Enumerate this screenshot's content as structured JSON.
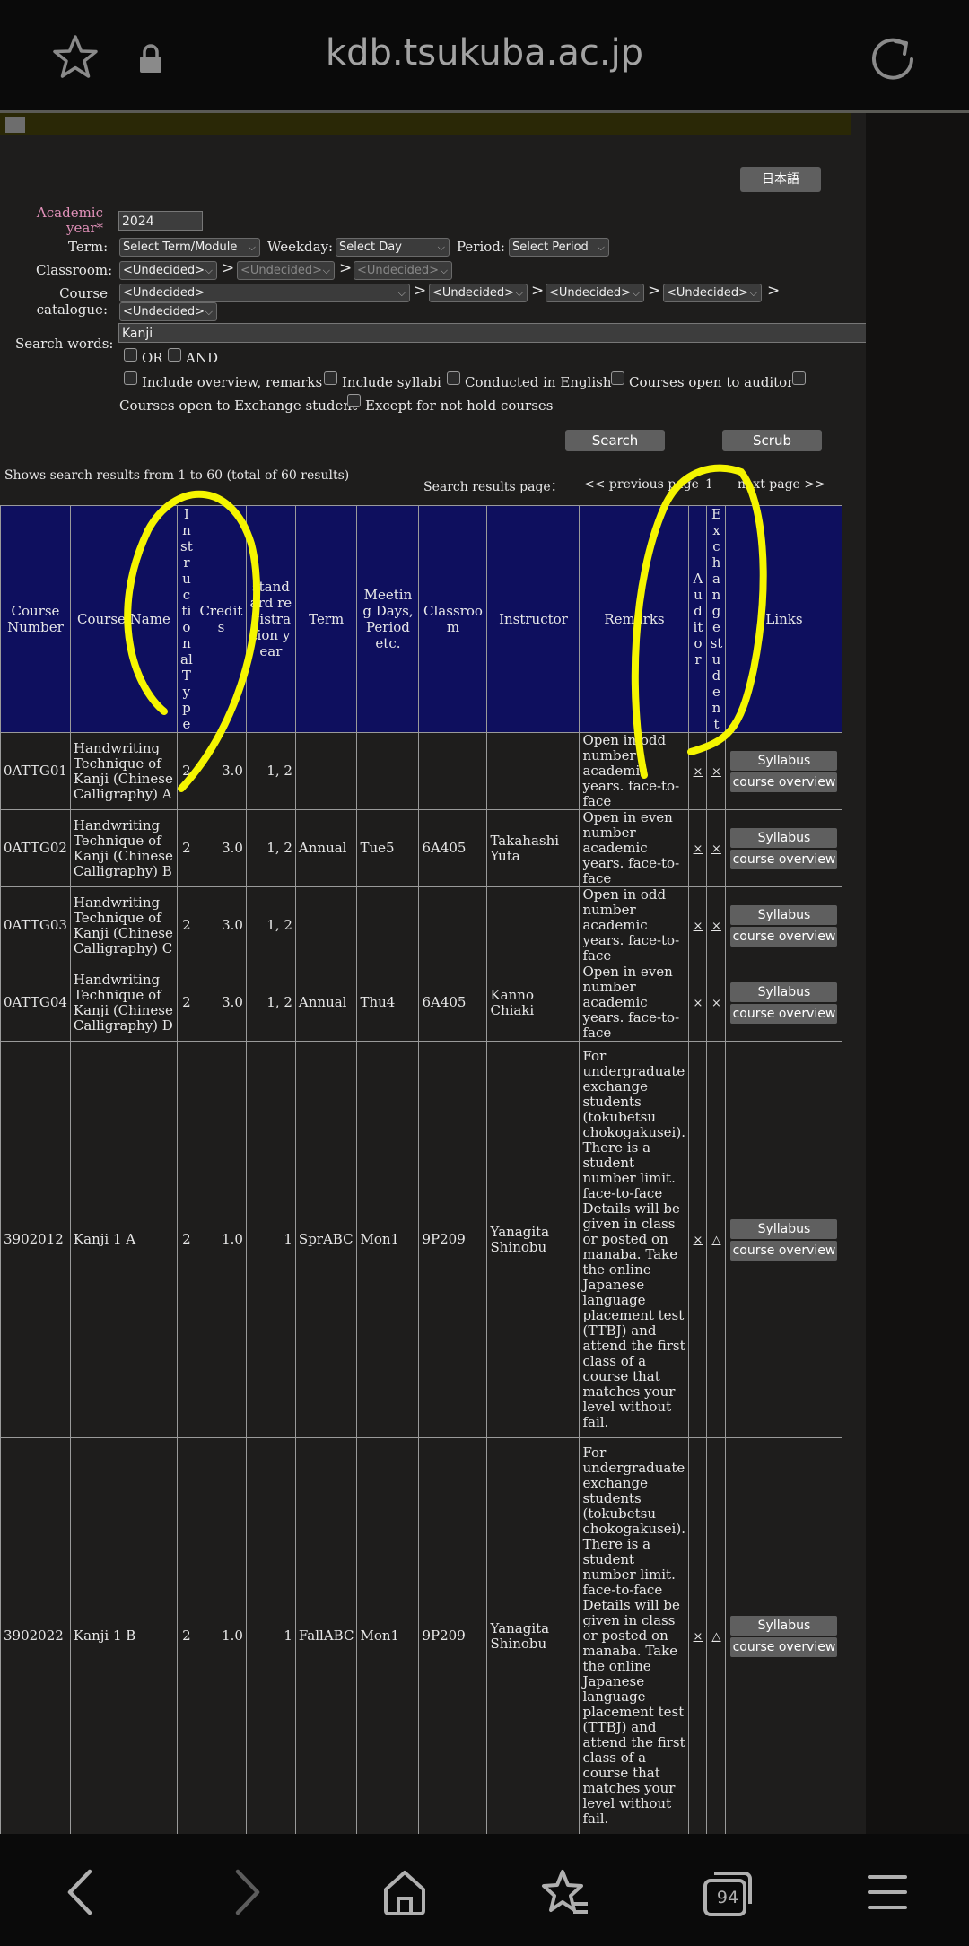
{
  "browser": {
    "url": "kdb.tsukuba.ac.jp",
    "tab_count": "94"
  },
  "page": {
    "lang_button": "日本語",
    "form": {
      "academic_year_label": "Academic year*",
      "academic_year_value": "2024",
      "term_label": "Term:",
      "term_value": "Select Term/Module",
      "weekday_label": "Weekday:",
      "weekday_value": "Select Day",
      "period_label": "Period:",
      "period_value": "Select Period",
      "classroom_label": "Classroom:",
      "undecided": "<Undecided>",
      "catalogue_label": "Course catalogue:",
      "search_words_label": "Search words:",
      "search_words_value": "Kanji",
      "opt_or": "OR",
      "opt_and": "AND",
      "opt_overview": "Include overview, remarks",
      "opt_syllabi": "Include syllabi",
      "opt_english": "Conducted in English",
      "opt_auditor": "Courses open to auditor",
      "opt_exchange": "Courses open to Exchange student",
      "opt_except": "Except for not hold courses",
      "search_button": "Search",
      "scrub_button": "Scrub"
    },
    "results": {
      "summary": "Shows search results from 1 to 60 (total of 60 results)",
      "page_label": "Search results page：",
      "prev": "<< previous page",
      "page_num": "1",
      "next": "next page >>"
    },
    "table": {
      "headers": {
        "course_number": "Course Number",
        "course_name": "Course Name",
        "instr_type": "Instructional Type",
        "credits": "Credits",
        "std_year": "standard registration year",
        "term": "Term",
        "meeting": "Meeting Days,Period etc.",
        "classroom": "Classroom",
        "instructor": "Instructor",
        "remarks": "Remarks",
        "auditor": "Auditor",
        "exchange": "Exchangestudent",
        "links": "Links"
      },
      "syllabus_label": "Syllabus",
      "overview_label": "course overview",
      "rows": [
        {
          "num": "0ATTG01",
          "name": "Handwriting Technique of Kanji (Chinese Calligraphy) A",
          "type": "2",
          "credits": "3.0",
          "year": "1, 2",
          "term": "",
          "meeting": "",
          "room": "",
          "instructor": "",
          "remarks": "Open in odd number academic years. face-to-face",
          "auditor": "×",
          "exchange": "×"
        },
        {
          "num": "0ATTG02",
          "name": "Handwriting Technique of Kanji (Chinese Calligraphy) B",
          "type": "2",
          "credits": "3.0",
          "year": "1, 2",
          "term": "Annual",
          "meeting": "Tue5",
          "room": "6A405",
          "instructor": "Takahashi Yuta",
          "remarks": "Open in even number academic years. face-to-face",
          "auditor": "×",
          "exchange": "×"
        },
        {
          "num": "0ATTG03",
          "name": "Handwriting Technique of Kanji (Chinese Calligraphy) C",
          "type": "2",
          "credits": "3.0",
          "year": "1, 2",
          "term": "",
          "meeting": "",
          "room": "",
          "instructor": "",
          "remarks": "Open in odd number academic years. face-to-face",
          "auditor": "×",
          "exchange": "×"
        },
        {
          "num": "0ATTG04",
          "name": "Handwriting Technique of Kanji (Chinese Calligraphy) D",
          "type": "2",
          "credits": "3.0",
          "year": "1, 2",
          "term": "Annual",
          "meeting": "Thu4",
          "room": "6A405",
          "instructor": "Kanno Chiaki",
          "remarks": "Open in even number academic years. face-to-face",
          "auditor": "×",
          "exchange": "×"
        },
        {
          "num": "3902012",
          "name": "Kanji 1 A",
          "type": "2",
          "credits": "1.0",
          "year": "1",
          "term": "SprABC",
          "meeting": "Mon1",
          "room": "9P209",
          "instructor": "Yanagita Shinobu",
          "remarks": "For undergraduate exchange students (tokubetsu chokogakusei). There is a student number limit. face-to-face Details will be given in class or posted on manaba. Take the online Japanese language placement test (TTBJ) and attend the first class of a course that matches your level without fail.",
          "auditor": "×",
          "exchange": "△"
        },
        {
          "num": "3902022",
          "name": "Kanji 1 B",
          "type": "2",
          "credits": "1.0",
          "year": "1",
          "term": "FallABC",
          "meeting": "Mon1",
          "room": "9P209",
          "instructor": "Yanagita Shinobu",
          "remarks": "For undergraduate exchange students (tokubetsu chokogakusei). There is a student number limit. face-to-face Details will be given in class or posted on manaba. Take the online Japanese language placement test (TTBJ) and attend the first class of a course that matches your level without fail.",
          "auditor": "×",
          "exchange": "△"
        },
        {
          "num": "",
          "name": "",
          "type": "",
          "credits": "",
          "year": "",
          "term": "",
          "meeting": "",
          "room": "",
          "instructor": "",
          "remarks": "For undergraduate",
          "auditor": "",
          "exchange": ""
        }
      ]
    }
  },
  "colors": {
    "header_bg": "#0e0f5e",
    "highlight": "#f5f500",
    "label_pink": "#e090b8"
  }
}
